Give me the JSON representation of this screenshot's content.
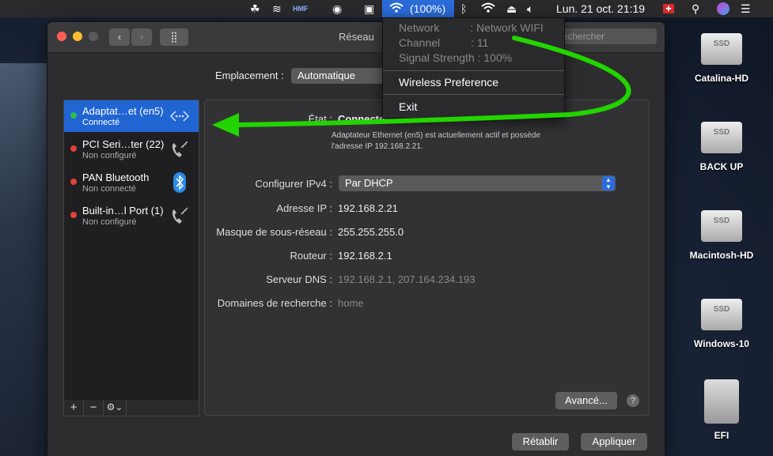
{
  "menubar": {
    "wifi_percent": "(100%)",
    "datetime": "Lun. 21 oct.  21:19",
    "icons": [
      "apps-icon",
      "stack-icon",
      "hmf-icon",
      "apple-icon",
      "eye-icon",
      "camera-icon",
      "wifi-icon",
      "bluetooth-icon",
      "wifi-icon",
      "eject-icon",
      "volume-icon",
      "flag-icon",
      "search-icon",
      "siri-icon",
      "list-icon"
    ],
    "hmf_text": "HMF"
  },
  "window": {
    "title": "Réseau",
    "search_placeholder": "Rechercher",
    "location_label": "Emplacement :",
    "location_value": "Automatique"
  },
  "services": [
    {
      "name": "Adaptat…et (en5)",
      "status": "Connecté",
      "dot": "#2dbf4e",
      "icon": "ethernet-icon",
      "selected": true
    },
    {
      "name": "PCI Seri…ter (22)",
      "status": "Non configuré",
      "dot": "#e0413a",
      "icon": "phone-icon",
      "selected": false
    },
    {
      "name": "PAN Bluetooth",
      "status": "Non connecté",
      "dot": "#e0413a",
      "icon": "bluetooth-icon",
      "selected": false
    },
    {
      "name": "Built-in…l Port (1)",
      "status": "Non configuré",
      "dot": "#e0413a",
      "icon": "phone-icon",
      "selected": false
    }
  ],
  "sidebar_tools": {
    "add": "+",
    "remove": "−",
    "gear": "⚙⌄"
  },
  "detail": {
    "state_label": "État :",
    "state_value": "Connecte",
    "state_desc_1": "Adaptateur Ethernet (en5) est actuellement actif et possède",
    "state_desc_2": "l'adresse IP 192.168.2.21.",
    "ipv4_label": "Configurer IPv4 :",
    "ipv4_value": "Par DHCP",
    "ip_label": "Adresse IP :",
    "ip_value": "192.168.2.21",
    "mask_label": "Masque de sous-réseau :",
    "mask_value": "255.255.255.0",
    "router_label": "Routeur :",
    "router_value": "192.168.2.1",
    "dns_label": "Serveur DNS :",
    "dns_value": "192.168.2.1, 207.164.234.193",
    "domains_label": "Domaines de recherche :",
    "domains_value": "home",
    "advanced": "Avancé...",
    "help": "?"
  },
  "footer": {
    "revert": "Rétablir",
    "apply": "Appliquer"
  },
  "wifi_menu": {
    "network": "Network          : Network WIFI",
    "channel": "Channel          : 11",
    "signal": "Signal Strength : 100%",
    "pref": "Wireless Preference",
    "exit": "Exit"
  },
  "desktop_disks": [
    {
      "name": "Catalina-HD",
      "badge": "SSD"
    },
    {
      "name": "BACK UP",
      "badge": "SSD"
    },
    {
      "name": "Macintosh-HD",
      "badge": "SSD"
    },
    {
      "name": "Windows-10",
      "badge": "SSD"
    },
    {
      "name": "EFI",
      "badge": ""
    }
  ],
  "colors": {
    "accent": "#2165d3",
    "arrow": "#22d400",
    "connected": "#2dbf4e",
    "disconnected": "#e0413a"
  }
}
